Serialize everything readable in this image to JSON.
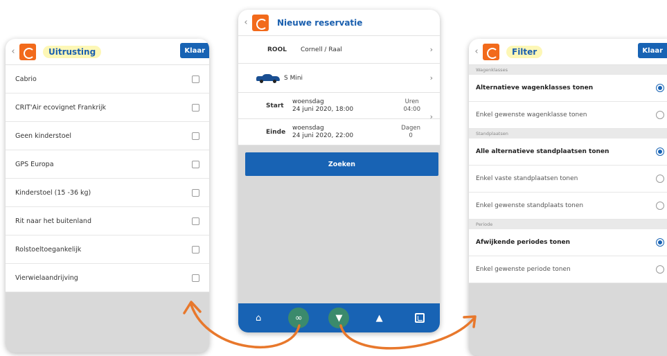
{
  "left_panel": {
    "title": "Uitrusting",
    "done_label": "Klaar",
    "items": [
      {
        "label": "Cabrio"
      },
      {
        "label": "CRIT'Air ecovignet Frankrijk"
      },
      {
        "label": "Geen kinderstoel"
      },
      {
        "label": "GPS Europa"
      },
      {
        "label": "Kinderstoel (15 -36 kg)"
      },
      {
        "label": "Rit naar het buitenland"
      },
      {
        "label": "Rolstoeltoegankelijk"
      },
      {
        "label": "Vierwielaandrijving"
      }
    ]
  },
  "center_panel": {
    "title": "Nieuwe reservatie",
    "location_code": "ROOL",
    "location_name": "Cornell / Raal",
    "car_name": "S Mini",
    "start_label": "Start",
    "start_day": "woensdag",
    "start_datetime": "24 juni 2020, 18:00",
    "duration_label": "Uren",
    "duration_value": "04:00",
    "end_label": "Einde",
    "end_day": "woensdag",
    "end_datetime": "24 juni 2020, 22:00",
    "days_label": "Dagen",
    "days_value": "0",
    "search_label": "Zoeken",
    "tabs": [
      "home-icon",
      "link-icon",
      "filter-icon",
      "person-icon",
      "app-icon"
    ]
  },
  "right_panel": {
    "title": "Filter",
    "done_label": "Klaar",
    "sections": [
      {
        "header": "Wagenklasses",
        "options": [
          {
            "label": "Alternatieve wagenklasses tonen",
            "selected": true
          },
          {
            "label": "Enkel gewenste wagenklasse tonen",
            "selected": false
          }
        ]
      },
      {
        "header": "Standplaatsen",
        "options": [
          {
            "label": "Alle alternatieve standplaatsen tonen",
            "selected": true
          },
          {
            "label": "Enkel vaste standplaatsen tonen",
            "selected": false
          },
          {
            "label": "Enkel gewenste standplaats tonen",
            "selected": false
          }
        ]
      },
      {
        "header": "Periode",
        "options": [
          {
            "label": "Afwijkende periodes tonen",
            "selected": true
          },
          {
            "label": "Enkel gewenste periode tonen",
            "selected": false
          }
        ]
      }
    ]
  },
  "colors": {
    "brand_orange": "#f26a1b",
    "primary_blue": "#1863b4",
    "tab_highlight": "#3b8a6c",
    "arrow": "#e8782c"
  }
}
